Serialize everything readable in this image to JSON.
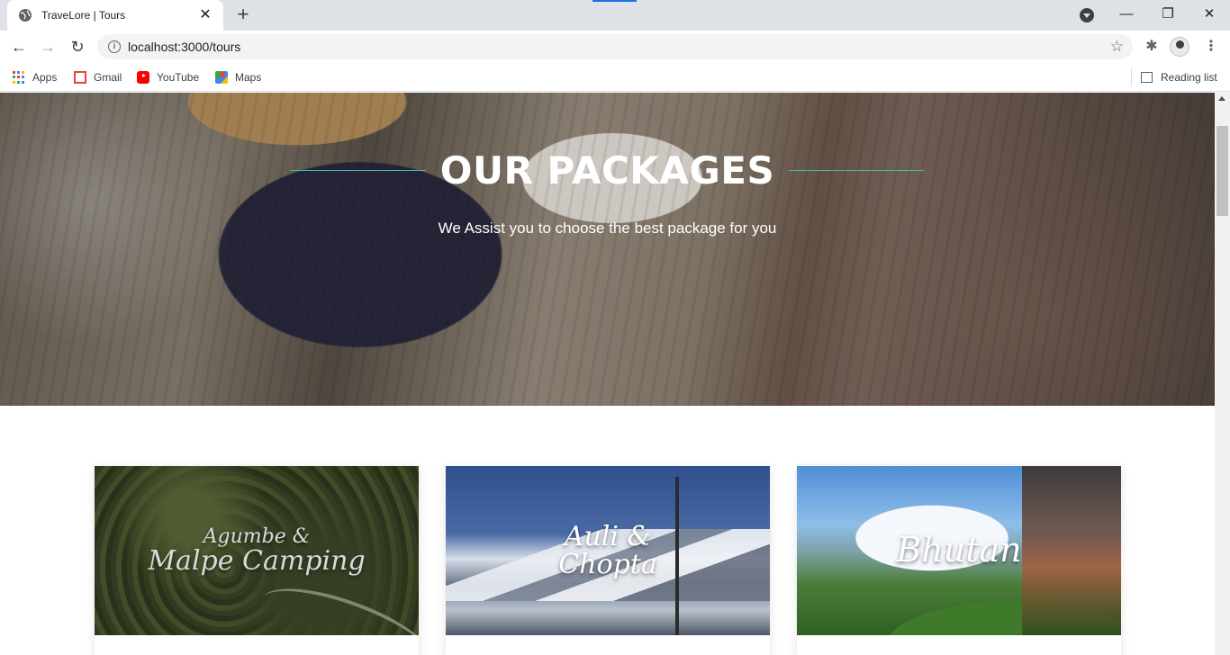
{
  "browser": {
    "tab_title": "TraveLore | Tours",
    "url": "localhost:3000/tours",
    "bookmarks": [
      {
        "label": "Apps",
        "icon": "apps-grid-icon"
      },
      {
        "label": "Gmail",
        "icon": "gmail-icon"
      },
      {
        "label": "YouTube",
        "icon": "youtube-icon"
      },
      {
        "label": "Maps",
        "icon": "maps-icon"
      }
    ],
    "reading_list": "Reading list"
  },
  "hero": {
    "title": "OUR PACKAGES",
    "subtitle": "We Assist you to choose the best package for you"
  },
  "packages": [
    {
      "line1": "Agumbe &",
      "line2": "Malpe Camping"
    },
    {
      "line1": "Auli &",
      "line2": "Chopta"
    },
    {
      "line1": "",
      "line2": "Bhutan"
    }
  ],
  "colors": {
    "accent_line": "#4fb0b0",
    "tab_accent": "#1a73e8"
  }
}
